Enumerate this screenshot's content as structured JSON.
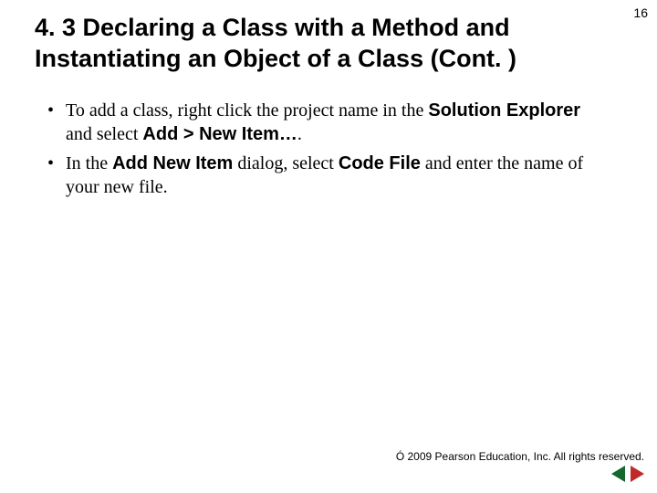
{
  "page_number": "16",
  "title": "4. 3  Declaring a Class with a Method and Instantiating an Object of a Class (Cont. )",
  "bullets": [
    {
      "pre": "To add a class, right click the project name in the ",
      "ui1": "Solution Explorer",
      "mid1": " and select ",
      "ui2": "Add > New Item…",
      "tail": "."
    },
    {
      "pre": "In the ",
      "ui1": "Add New Item",
      "mid1": " dialog, select ",
      "ui2": "Code File",
      "tail": " and enter the name of your new file."
    }
  ],
  "copyright": "Ó 2009 Pearson Education, Inc.  All rights reserved."
}
